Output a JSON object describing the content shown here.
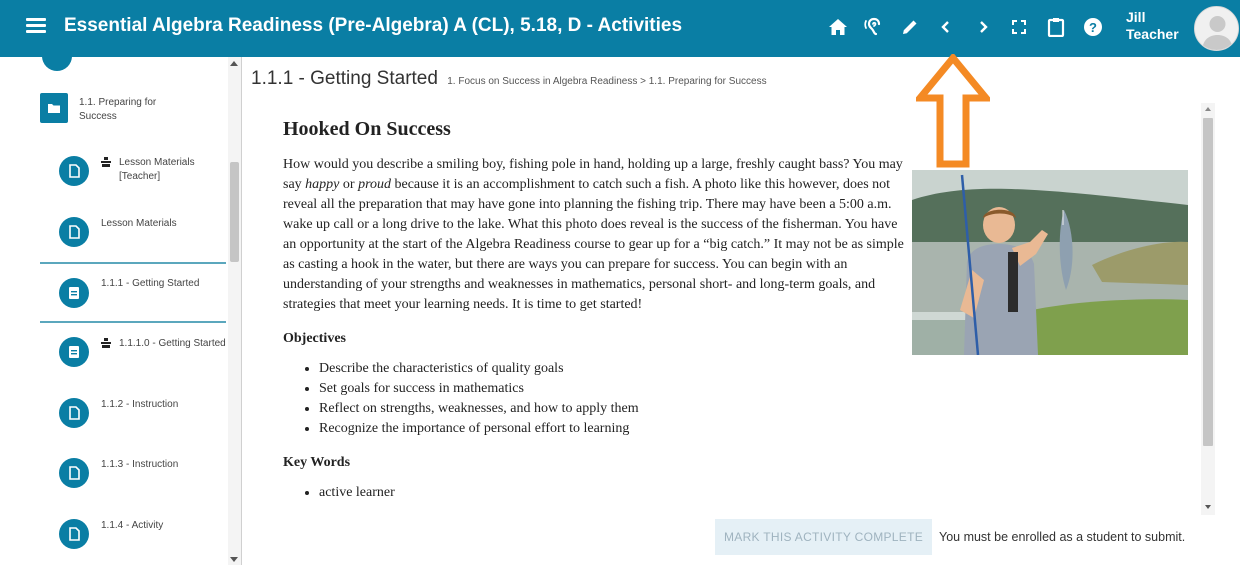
{
  "header": {
    "title": "Essential Algebra Readiness (Pre-Algebra) A (CL), 5.18, D - Activities",
    "icons": [
      "menu-icon",
      "home-icon",
      "ear-icon",
      "pencil-icon",
      "chevron-left-icon",
      "chevron-right-icon",
      "fullscreen-icon",
      "clipboard-icon",
      "help-icon"
    ],
    "user_first": "Jill",
    "user_last": "Teacher"
  },
  "sidebar": {
    "folder_label": "1.1. Preparing for Success",
    "items": [
      {
        "label": "Lesson Materials [Teacher]",
        "teacher": true,
        "icon": "file-icon"
      },
      {
        "label": "Lesson Materials",
        "teacher": false,
        "icon": "file-icon"
      },
      {
        "label": "1.1.1 - Getting Started",
        "teacher": false,
        "icon": "page-icon",
        "selected": true
      },
      {
        "label": "1.1.1.0 - Getting Started",
        "teacher": true,
        "icon": "page-icon"
      },
      {
        "label": "1.1.2 - Instruction",
        "teacher": false,
        "icon": "file-icon"
      },
      {
        "label": "1.1.3 - Instruction",
        "teacher": false,
        "icon": "file-icon"
      },
      {
        "label": "1.1.4 - Activity",
        "teacher": false,
        "icon": "file-icon"
      }
    ]
  },
  "content": {
    "title": "1.1.1 - Getting Started",
    "breadcrumb": "1. Focus on Success in Algebra Readiness > 1.1. Preparing for Success",
    "heading": "Hooked On Success",
    "intro_a": "How would you describe a smiling boy, fishing pole in hand, holding up a large, freshly caught bass? You may say ",
    "intro_em1": "happy",
    "intro_b": " or ",
    "intro_em2": "proud",
    "intro_c": " because it is an accomplishment to catch such a fish. A photo like this however, does not reveal all the preparation that may have gone into planning the fishing trip. There may have been a 5:00 a.m. wake up call or a long drive to the lake. What this photo does reveal is the success of the fisherman. You have an opportunity at the start of the Algebra Readiness course to gear up for a “big catch.” It may not be as simple as casting a hook in the water, but there are ways you can prepare for success. You can begin with an understanding of your strengths and weaknesses in mathematics, personal short- and long-term goals, and strategies that meet your learning needs. It is time to get started!",
    "objectives_heading": "Objectives",
    "objectives": [
      "Describe the characteristics of quality goals",
      "Set goals for success in mathematics",
      "Reflect on strengths, weaknesses, and how to apply them",
      "Recognize the importance of personal effort to learning"
    ],
    "keywords_heading": "Key Words",
    "keywords": [
      "active learner"
    ]
  },
  "footer": {
    "mark_complete": "MARK THIS ACTIVITY COMPLETE",
    "enroll_note": "You must be enrolled as a student to submit."
  },
  "colors": {
    "brand": "#0a7ea4",
    "annotation_arrow": "#f48a24"
  }
}
